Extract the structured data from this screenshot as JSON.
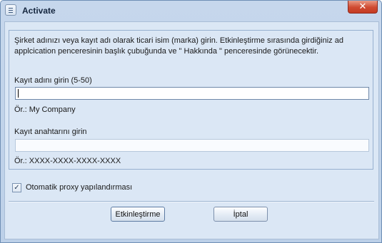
{
  "window": {
    "title": "Activate",
    "close_glyph": "✕"
  },
  "instructions": "Şirket adınızı veya kayıt adı olarak ticari isim (marka) girin. Etkinleştirme sırasında girdiğiniz ad applcication penceresinin başlık çubuğunda ve \" Hakkında \" penceresinde görünecektir.",
  "name_field": {
    "label": "Kayıt adını girin (5-50)",
    "value": "",
    "example": "Ör.: My Company"
  },
  "key_field": {
    "label": "Kayıt anahtarını girin",
    "value": "",
    "example": "Ör.: XXXX-XXXX-XXXX-XXXX"
  },
  "proxy": {
    "label": "Otomatik proxy yapılandırması",
    "checked": true,
    "check_glyph": "✓"
  },
  "buttons": {
    "activate_label": "Etkinleştirme",
    "cancel_label": "İptal"
  },
  "icons": {
    "system_menu": "window-menu-icon",
    "close": "close-icon",
    "checkbox": "checkmark-icon"
  },
  "colors": {
    "frame": "#c6d7ec",
    "client": "#dbe7f5",
    "close_button": "#cf4a31"
  }
}
